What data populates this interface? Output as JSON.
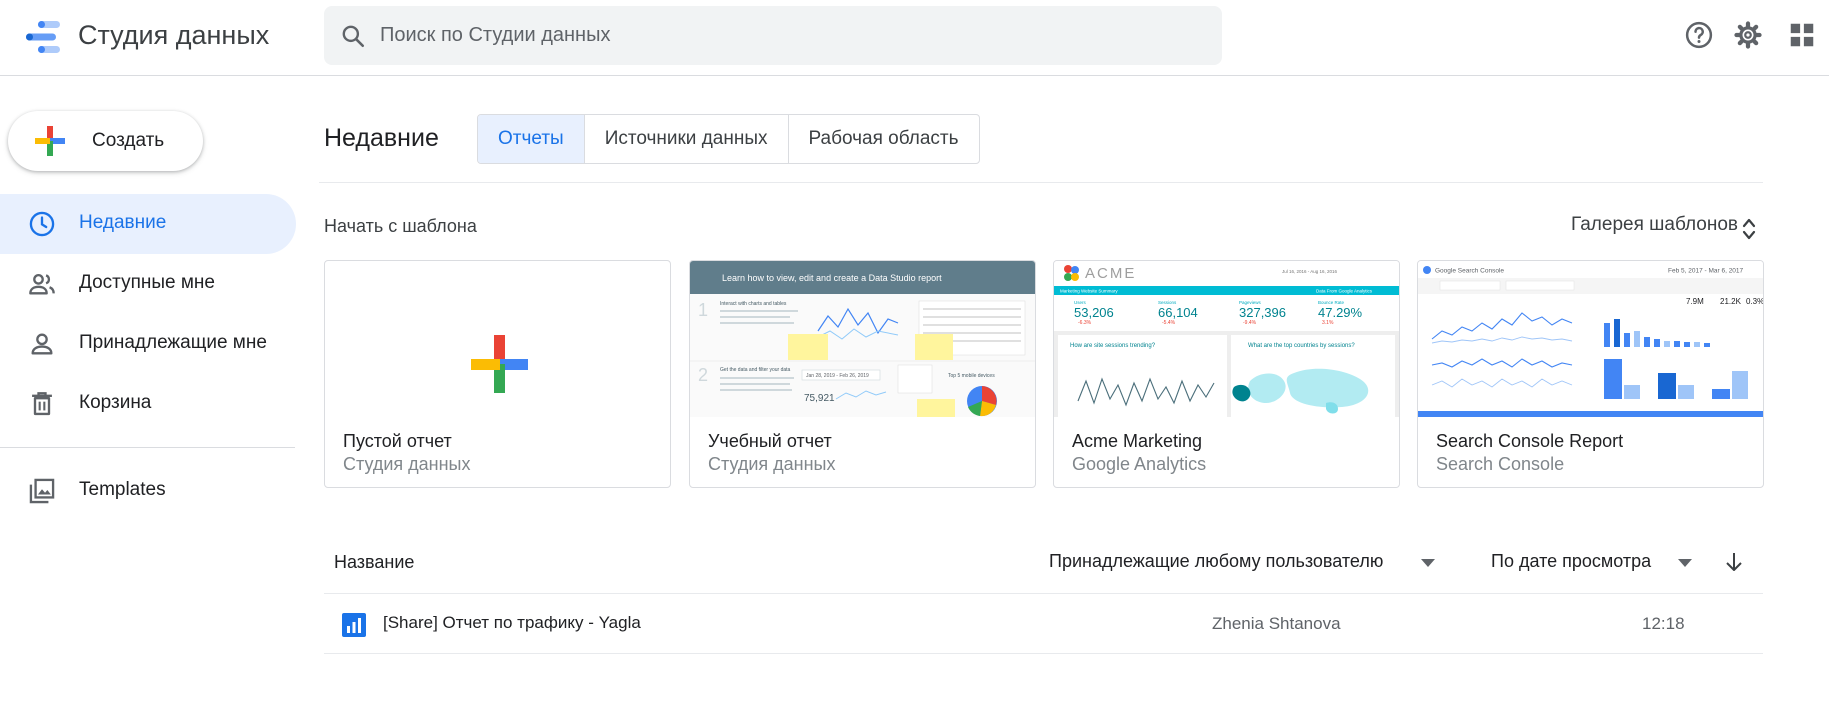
{
  "header": {
    "app_title": "Студия данных",
    "search_placeholder": "Поиск по Студии данных"
  },
  "sidebar": {
    "create_label": "Создать",
    "items": [
      {
        "label": "Недавние",
        "icon": "clock-icon",
        "active": true
      },
      {
        "label": "Доступные мне",
        "icon": "people-icon",
        "active": false
      },
      {
        "label": "Принадлежащие мне",
        "icon": "person-icon",
        "active": false
      },
      {
        "label": "Корзина",
        "icon": "trash-icon",
        "active": false
      },
      {
        "label": "Templates",
        "icon": "templates-icon",
        "active": false
      }
    ]
  },
  "main": {
    "section_title": "Недавние",
    "tabs": [
      {
        "label": "Отчеты",
        "active": true
      },
      {
        "label": "Источники данных",
        "active": false
      },
      {
        "label": "Рабочая область",
        "active": false
      }
    ],
    "templates_label": "Начать с шаблона",
    "gallery_label": "Галерея шаблонов",
    "templates": [
      {
        "title": "Пустой отчет",
        "subtitle": "Студия данных"
      },
      {
        "title": "Учебный отчет",
        "subtitle": "Студия данных",
        "thumb": {
          "banner": "Learn how to view, edit and create a Data Studio report",
          "step1": "Interact with charts and tables",
          "step2": "Get the data and filter your data",
          "date_range": "Jan 28, 2019 - Feb 26, 2019",
          "metric": "75,921",
          "pie_title": "Top 5 mobile devices"
        }
      },
      {
        "title": "Acme Marketing",
        "subtitle": "Google Analytics",
        "thumb": {
          "brand": "ACME",
          "date_range": "Jul 16, 2016 - Aug 16, 2016",
          "bar_left": "Marketing Website Summary",
          "bar_right": "Data From Google Analytics",
          "kpis": [
            {
              "label": "Users",
              "value": "53,206",
              "delta": "-6.3%"
            },
            {
              "label": "Sessions",
              "value": "66,104",
              "delta": "-5.4%"
            },
            {
              "label": "Pageviews",
              "value": "327,396",
              "delta": "-9.4%"
            },
            {
              "label": "Bounce Rate",
              "value": "47.29%",
              "delta": "3.1%"
            }
          ],
          "panel_left": "How are site sessions trending?",
          "panel_right": "What are the top countries by sessions?"
        }
      },
      {
        "title": "Search Console Report",
        "subtitle": "Search Console",
        "thumb": {
          "brand": "Google Search Console",
          "date_range": "Feb 5, 2017 - Mar 6, 2017",
          "kpi_values": [
            "7.9M",
            "21.2K",
            "0.3%"
          ]
        }
      }
    ]
  },
  "list": {
    "name_header": "Название",
    "owner_filter": "Принадлежащие любому пользователю",
    "sort_label": "По дате просмотра",
    "rows": [
      {
        "name": "[Share] Отчет по трафику - Yagla",
        "owner": "Zhenia Shtanova",
        "time": "12:18"
      }
    ]
  },
  "colors": {
    "accent": "#1a73e8",
    "active_bg": "#e8f0fe",
    "google_red": "#ea4335",
    "google_blue": "#4285f4",
    "google_yellow": "#fbbc04",
    "google_green": "#34a853",
    "acme_teal": "#00bcd4"
  }
}
